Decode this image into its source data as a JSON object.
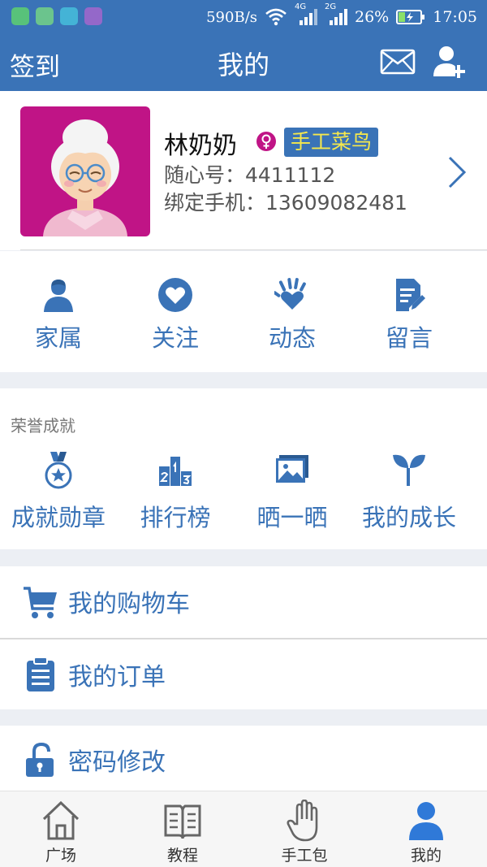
{
  "status_bar": {
    "net_speed": "590B/s",
    "sig1_label": "4G",
    "sig2_label": "2G",
    "battery": "26%",
    "time": "17:05"
  },
  "header": {
    "left_label": "签到",
    "title": "我的",
    "mail_icon": "mail-icon",
    "add_user_icon": "add-user-icon"
  },
  "profile": {
    "name": "林奶奶",
    "gender_icon": "female-icon",
    "level_badge": "手工菜鸟",
    "id_line": "随心号：4411112",
    "phone_line": "绑定手机：13609082481"
  },
  "quick_menu": [
    {
      "label": "家属",
      "icon": "person-icon"
    },
    {
      "label": "关注",
      "icon": "heart-icon"
    },
    {
      "label": "动态",
      "icon": "hand-heart-icon"
    },
    {
      "label": "留言",
      "icon": "note-edit-icon"
    }
  ],
  "honors": {
    "title": "荣誉成就",
    "items": [
      {
        "label": "成就勋章",
        "icon": "medal-icon"
      },
      {
        "label": "排行榜",
        "icon": "podium-icon"
      },
      {
        "label": "晒一晒",
        "icon": "photo-icon"
      },
      {
        "label": "我的成长",
        "icon": "sprout-icon"
      }
    ]
  },
  "rows": {
    "cart": "我的购物车",
    "orders": "我的订单",
    "password": "密码修改"
  },
  "bottom_nav": [
    {
      "label": "广场",
      "icon": "home-icon",
      "active": false
    },
    {
      "label": "教程",
      "icon": "book-icon",
      "active": false
    },
    {
      "label": "手工包",
      "icon": "hand-icon",
      "active": false
    },
    {
      "label": "我的",
      "icon": "user-icon",
      "active": true
    }
  ],
  "colors": {
    "primary": "#3a73b7",
    "badge_text": "#f6e84c",
    "avatar_bg": "#c01486",
    "active_tab": "#2f79d8",
    "background": "#eceff4"
  }
}
